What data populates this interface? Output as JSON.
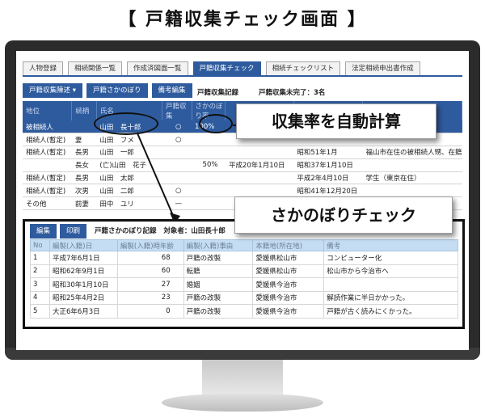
{
  "title": "【 戸籍収集チェック画面 】",
  "tabs": [
    {
      "label": "人物登録"
    },
    {
      "label": "相続関係一覧"
    },
    {
      "label": "作成済図面一覧"
    },
    {
      "label": "戸籍収集チェック"
    },
    {
      "label": "相続チェックリスト"
    },
    {
      "label": "法定相続申出書作成"
    }
  ],
  "toolbar": {
    "collect_btn": "戸籍収集陳述 ▾",
    "trace_btn": "戸籍さかのぼり",
    "memo_btn": "備考編集",
    "record_label": "戸籍収集記録",
    "incomplete_label": "戸籍収集未完了：3名"
  },
  "grid": {
    "columns": [
      "地位",
      "続柄",
      "氏名",
      "戸籍収集",
      "さかのぼり率",
      "",
      "",
      "",
      ""
    ],
    "rows": [
      [
        "被相続人",
        "",
        "山田　長十郎",
        "○",
        "100%",
        "",
        "",
        "",
        ""
      ],
      [
        "相続人(暫定)",
        "妻",
        "山田　フメ",
        "○",
        "",
        "",
        "",
        "",
        ""
      ],
      [
        "相続人(暫定)",
        "長男",
        "山田　一郎",
        "",
        "",
        "",
        "昭和51年1月",
        "",
        "",
        "福山市在住の被相続人甥、在籍"
      ],
      [
        "",
        "長女",
        "(亡)山田　花子",
        "",
        "50%",
        "平成20年1月10日",
        "昭和37年1月10日",
        ""
      ],
      [
        "相続人(暫定)",
        "長男",
        "山田　太郎",
        "",
        "",
        "",
        "平成2年4月10日",
        "学生（東京在住）"
      ],
      [
        "相続人(暫定)",
        "次男",
        "山田　二郎",
        "○",
        "",
        "",
        "昭和41年12月20日",
        ""
      ],
      [
        "その他",
        "前妻",
        "田中　ユリ",
        "—",
        "",
        "",
        "",
        ""
      ]
    ]
  },
  "callouts": {
    "rate": "収集率を自動計算",
    "trace": "さかのぼりチェック"
  },
  "panel": {
    "edit_btn": "編集",
    "print_btn": "印刷",
    "record_label": "戸籍さかのぼり記録",
    "target_label": "対象者：山田長十郎",
    "columns": [
      "No",
      "編製(入籍)日",
      "編製(入籍)時年齢",
      "編製(入籍)事由",
      "本籍地(所在地)",
      "備考"
    ],
    "rows": [
      [
        "1",
        "平成7年6月1日",
        "68",
        "戸籍の改製",
        "愛媛県松山市",
        "コンピューター化"
      ],
      [
        "2",
        "昭和62年9月1日",
        "60",
        "転籍",
        "愛媛県松山市",
        "松山市から今治市へ"
      ],
      [
        "3",
        "昭和30年1月10日",
        "27",
        "婚姻",
        "愛媛県今治市",
        ""
      ],
      [
        "4",
        "昭和25年4月2日",
        "23",
        "戸籍の改製",
        "愛媛県今治市",
        "解読作業に半日かかった。"
      ],
      [
        "5",
        "大正6年6月3日",
        "0",
        "戸籍の改製",
        "愛媛県今治市",
        "戸籍が古く読みにくかった。"
      ]
    ]
  }
}
